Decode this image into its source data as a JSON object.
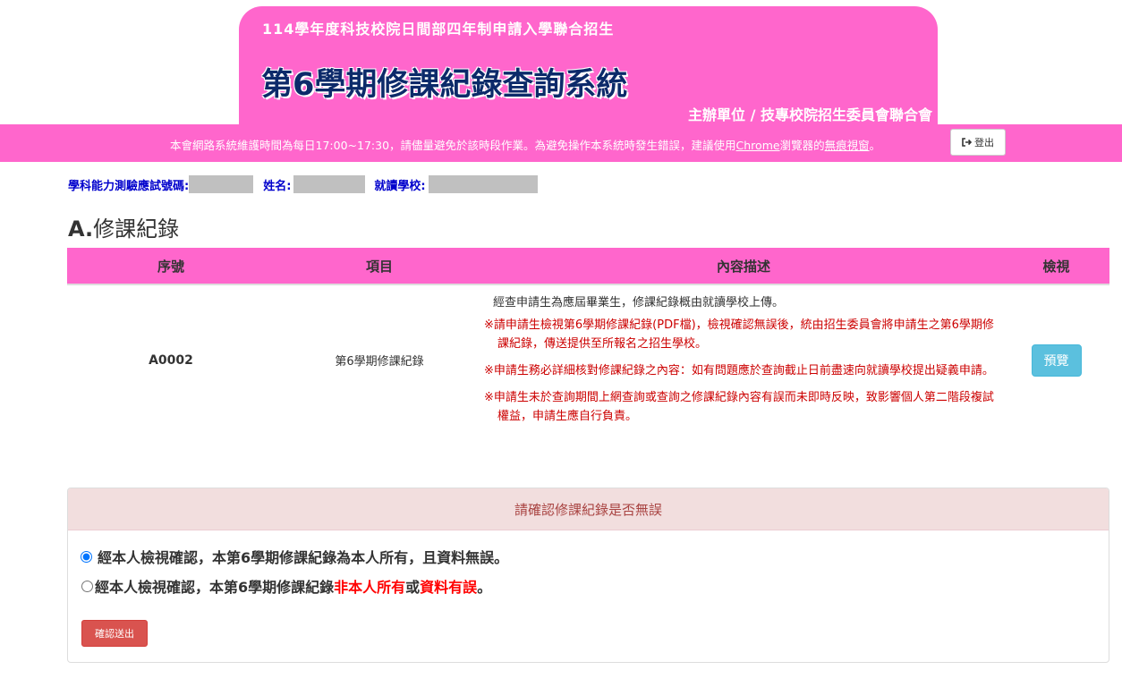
{
  "header": {
    "subtitle": "114學年度科技校院日間部四年制申請入學聯合招生",
    "title": "第6學期修課紀錄查詢系統",
    "organizer": "主辦單位 / 技專校院招生委員會聯合會"
  },
  "notice": {
    "text_before": "本會網路系統維護時間為每日17:00~17:30，請儘量避免於該時段作業。為避免操作本系統時發生錯誤，建議使用",
    "chrome_link": "Chrome",
    "text_middle": "瀏覽器的",
    "incognito_link": "無痕視窗",
    "text_after": "。"
  },
  "logout_label": "登出",
  "info": {
    "exam_no_label": "學科能力測驗應試號碼:",
    "name_label": "姓名:",
    "school_label": "就讀學校:"
  },
  "section": {
    "prefix": "A.",
    "title": "修課紀錄"
  },
  "table": {
    "headers": [
      "序號",
      "項目",
      "內容描述",
      "檢視"
    ],
    "row": {
      "serial": "A0002",
      "item": "第6學期修課紀錄",
      "desc_intro": "經查申請生為應屆畢業生，修課紀錄概由就讀學校上傳。",
      "notes": [
        "※請申請生檢視第6學期修課紀錄(PDF檔)，檢視確認無誤後，統由招生委員會將申請生之第6學期修課紀錄，傳送提供至所報名之招生學校。",
        "※申請生務必詳細核對修課紀錄之內容：如有問題應於查詢截止日前盡速向就讀學校提出疑義申請。",
        "※申請生未於查詢期間上網查詢或查詢之修課紀錄內容有誤而未即時反映，致影響個人第二階段複試權益，申請生應自行負責。"
      ],
      "view_label": "預覽"
    }
  },
  "confirm": {
    "heading": "請確認修課紀錄是否無誤",
    "option1": "經本人檢視確認，本第6學期修課紀錄為本人所有，且資料無誤。",
    "option2_prefix": "經本人檢視確認，本第6學期修課紀錄",
    "option2_red1": "非本人所有",
    "option2_mid": "或",
    "option2_red2": "資料有誤",
    "option2_suffix": "。",
    "option1_selected": true,
    "submit_label": "確認送出"
  }
}
